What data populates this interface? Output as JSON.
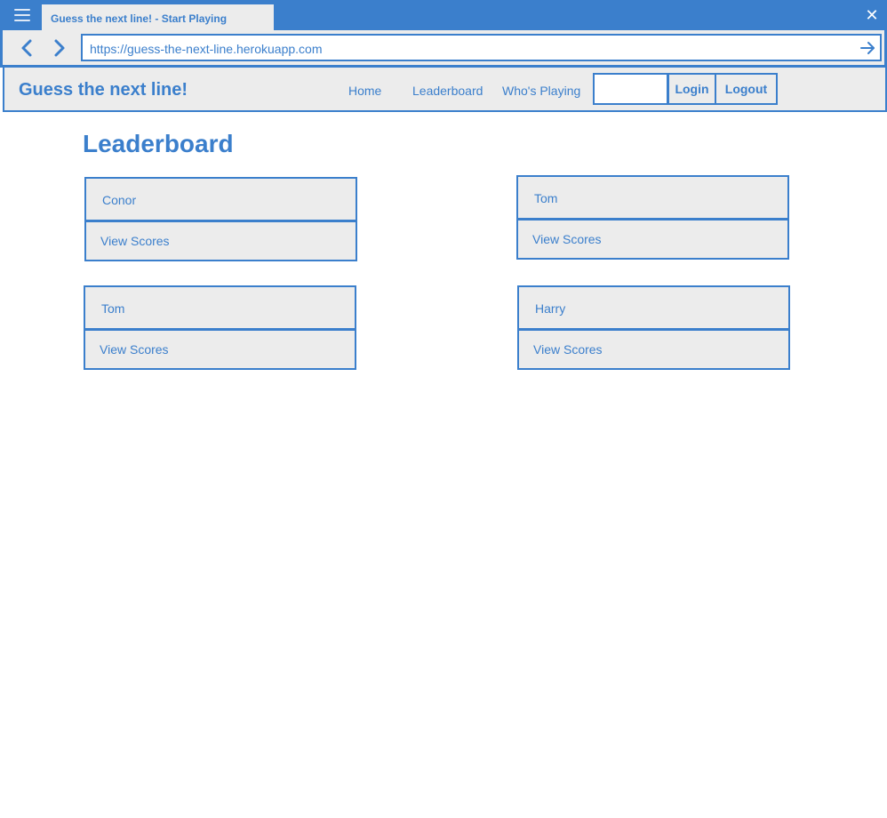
{
  "browser": {
    "tab_title": "Guess the next line! - Start Playing",
    "url": "https://guess-the-next-line.herokuapp.com",
    "close_glyph": "✕"
  },
  "header": {
    "site_title": "Guess the next line!",
    "nav": {
      "home": "Home",
      "leaderboard": "Leaderboard",
      "whos_playing": "Who's Playing"
    },
    "login_input_value": "",
    "login_label": "Login",
    "logout_label": "Logout"
  },
  "main": {
    "heading": "Leaderboard",
    "players": [
      {
        "name": "Conor",
        "action": "View Scores"
      },
      {
        "name": "Tom",
        "action": "View Scores"
      },
      {
        "name": "Tom",
        "action": "View Scores"
      },
      {
        "name": "Harry",
        "action": "View Scores"
      }
    ]
  },
  "colors": {
    "accent": "#3b7fcc",
    "panel_bg": "#ececec",
    "page_bg": "#ffffff"
  },
  "icons": {
    "menu": "hamburger-menu-icon",
    "close": "close-icon",
    "back": "chevron-left-icon",
    "forward": "chevron-right-icon",
    "go": "arrow-right-icon"
  }
}
